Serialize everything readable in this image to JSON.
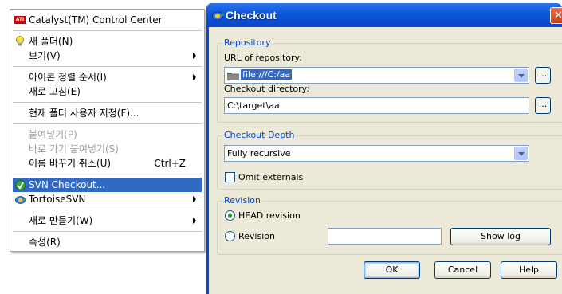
{
  "context_menu": {
    "ati_label": "Catalyst(TM) Control Center",
    "new_folder": "새 폴더(N)",
    "view": "보기(V)",
    "arrange_icons": "아이콘 정렬 순서(I)",
    "refresh": "새로 고침(E)",
    "customize_folder": "현재 폴더 사용자 지정(F)...",
    "paste": "붙여넣기(P)",
    "paste_shortcut": "바로 가기 붙여넣기(S)",
    "undo_rename": "이름 바꾸기 취소(U)",
    "undo_rename_shortcut": "Ctrl+Z",
    "svn_checkout": "SVN Checkout...",
    "tortoise_svn": "TortoiseSVN",
    "new": "새로 만들기(W)",
    "properties": "속성(R)"
  },
  "dialog": {
    "title": "Checkout",
    "close_glyph": "✕",
    "repository": {
      "group_title": "Repository",
      "url_label": "URL of repository:",
      "url_value": "file:///C:/aa",
      "dir_label": "Checkout directory:",
      "dir_value": "C:\\target\\aa",
      "browse_label": "..."
    },
    "depth": {
      "group_title": "Checkout Depth",
      "selected": "Fully recursive",
      "omit_externals": "Omit externals",
      "omit_externals_checked": false
    },
    "revision": {
      "group_title": "Revision",
      "head_label": "HEAD revision",
      "revision_label": "Revision",
      "selected": "HEAD revision",
      "revision_value": "",
      "show_log": "Show log"
    },
    "buttons": {
      "ok": "OK",
      "cancel": "Cancel",
      "help": "Help"
    }
  },
  "colors": {
    "menu_highlight": "#316ac5",
    "group_title": "#0046d5",
    "titlebar": "#0b55d9",
    "dialog_face": "#ece9d8"
  }
}
